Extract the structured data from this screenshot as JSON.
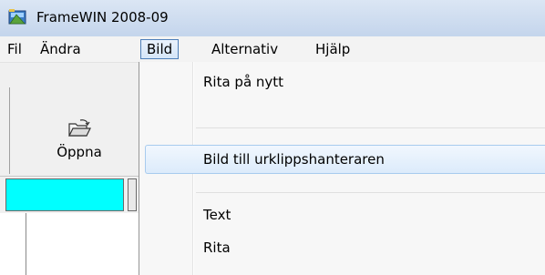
{
  "window": {
    "title": "FrameWIN 2008-09"
  },
  "menubar": {
    "items": [
      {
        "label": "Fil"
      },
      {
        "label": "Ändra"
      },
      {
        "label": "Bild"
      },
      {
        "label": "Alternativ"
      },
      {
        "label": "Hjälp"
      }
    ],
    "active": "Bild"
  },
  "toolbar": {
    "open_label": "Öppna",
    "open_icon": "open-folder-icon"
  },
  "dropdown": {
    "items": [
      {
        "label": "Rita på nytt"
      },
      {
        "label": "Bild till urklippshanteraren"
      },
      {
        "label": "Text"
      },
      {
        "label": "Rita"
      }
    ],
    "highlighted": "Bild till urklippshanteraren"
  },
  "colors": {
    "cyan_field": "#00ffff",
    "menu_active_border": "#4d7fb9",
    "highlight_border": "#a8cbee"
  }
}
